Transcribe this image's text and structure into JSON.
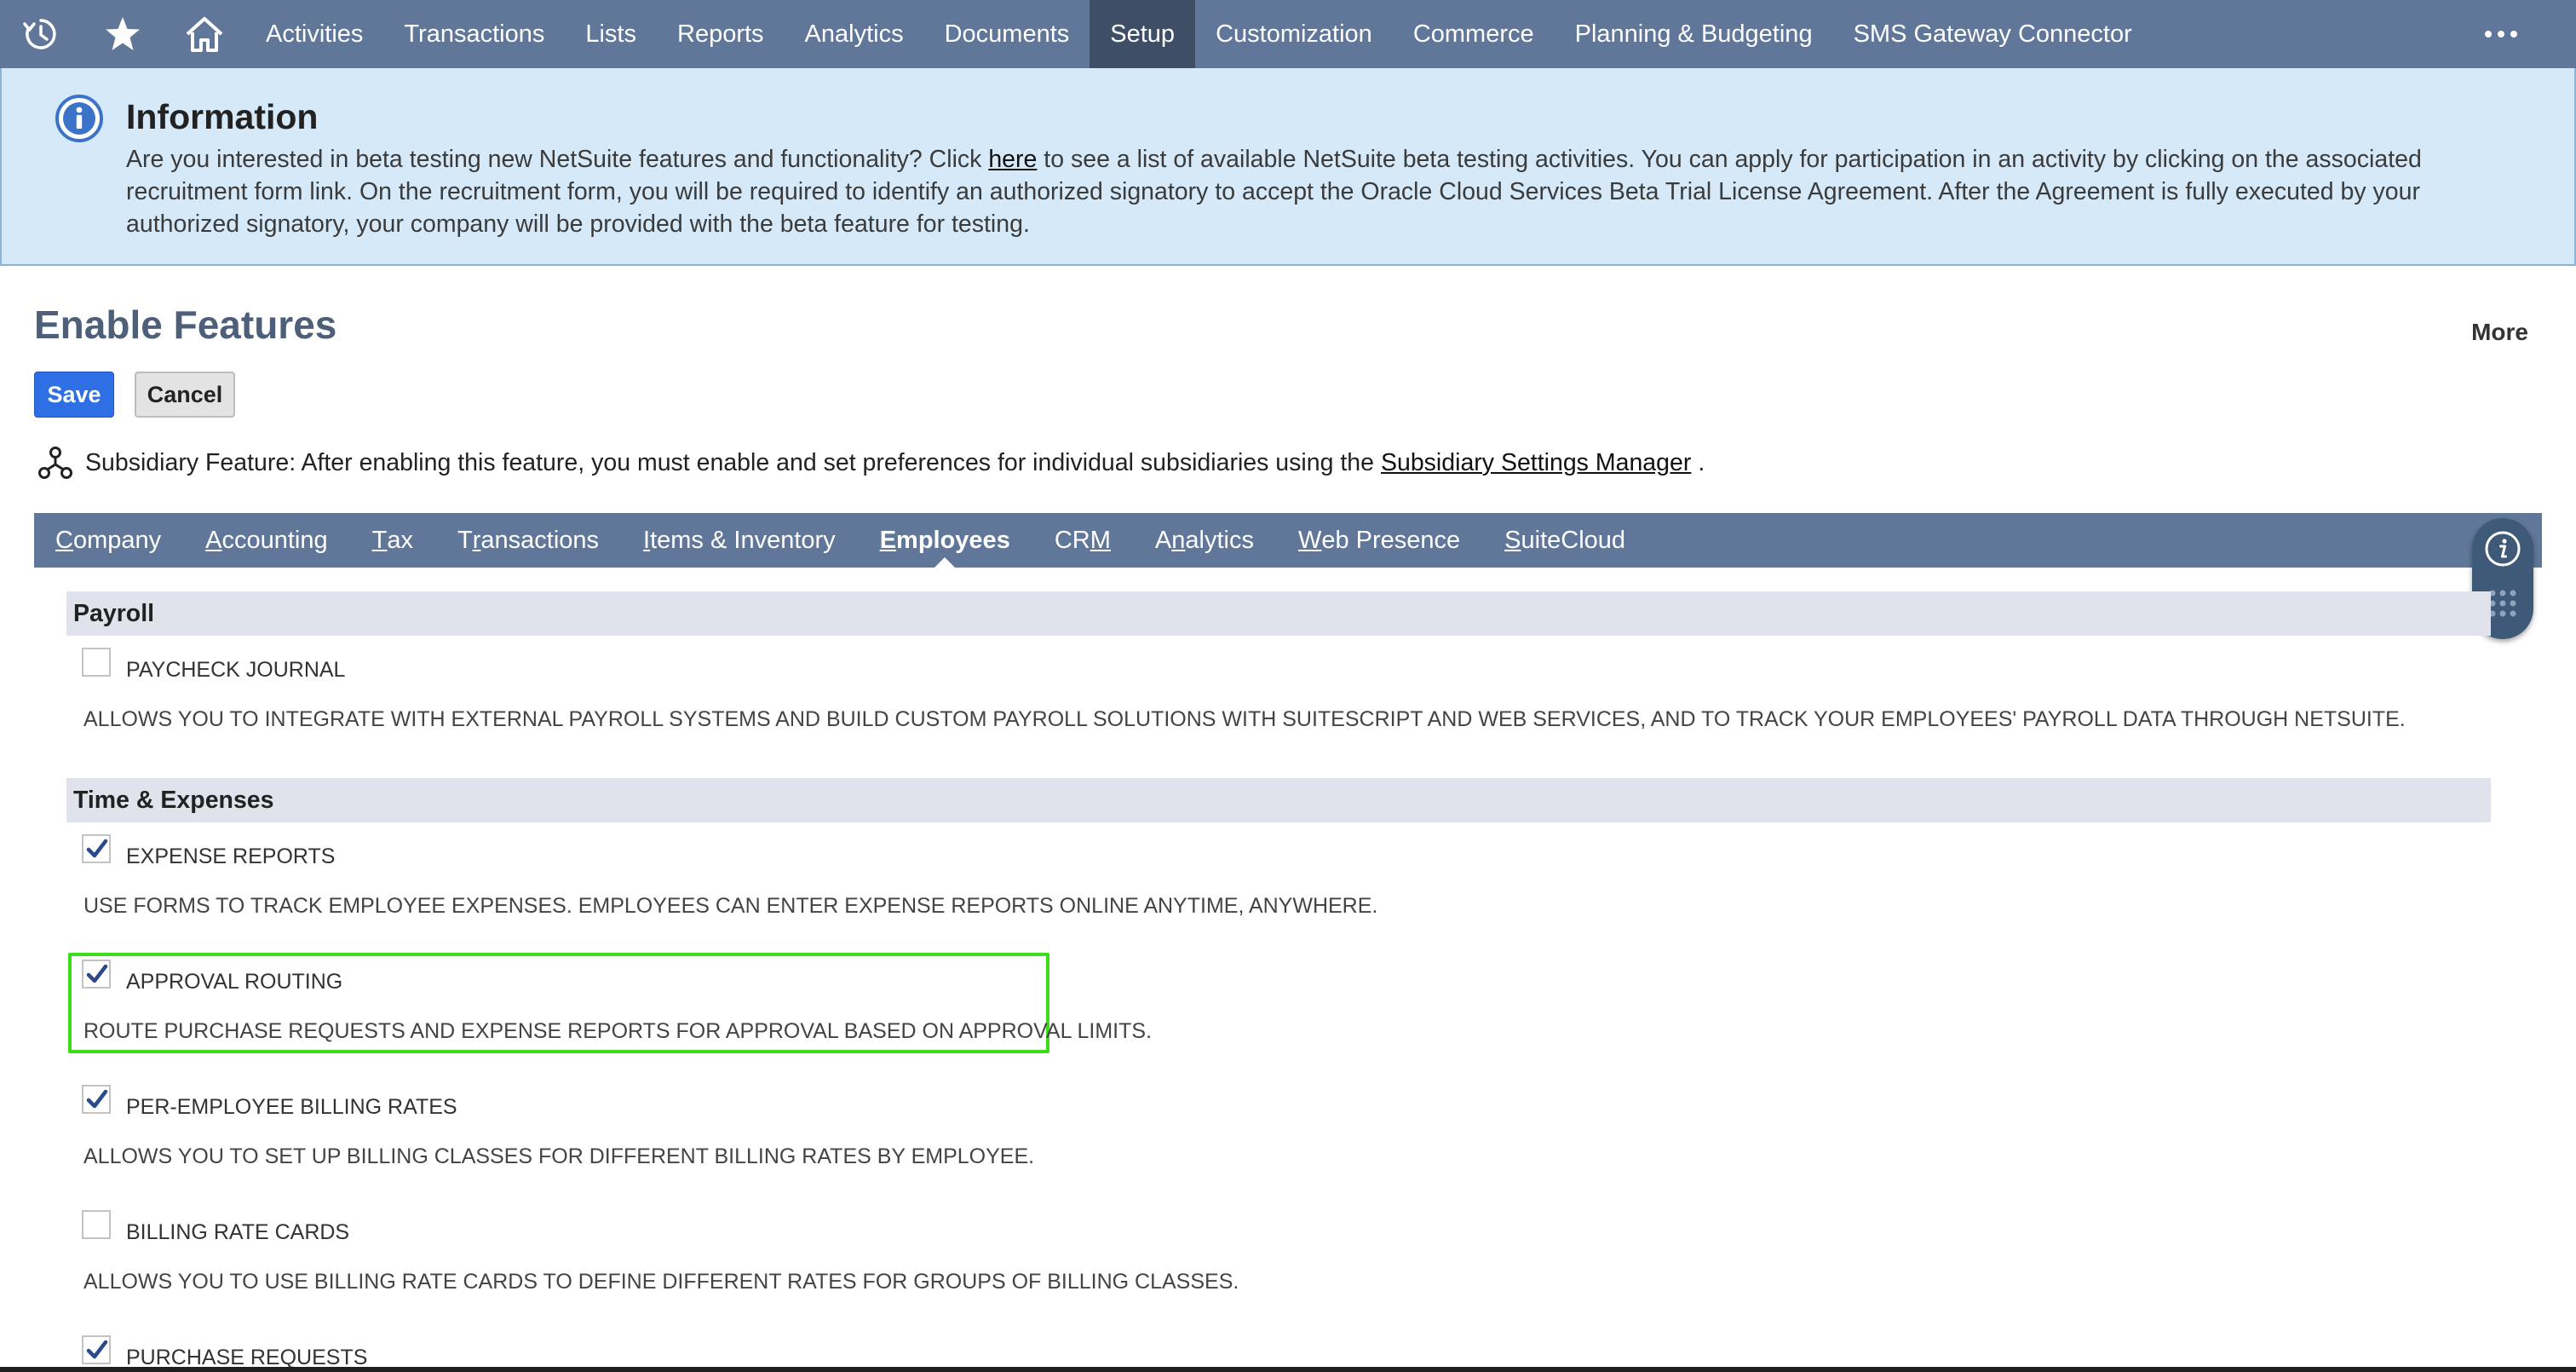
{
  "topnav": {
    "icons": [
      "recent-records-icon",
      "star-icon",
      "home-icon"
    ],
    "items": [
      {
        "label": "Activities"
      },
      {
        "label": "Transactions"
      },
      {
        "label": "Lists"
      },
      {
        "label": "Reports"
      },
      {
        "label": "Analytics"
      },
      {
        "label": "Documents"
      },
      {
        "label": "Setup",
        "active": true
      },
      {
        "label": "Customization"
      },
      {
        "label": "Commerce"
      },
      {
        "label": "Planning & Budgeting"
      },
      {
        "label": "SMS Gateway Connector"
      }
    ],
    "more_icon": "ellipsis-icon"
  },
  "banner": {
    "title": "Information",
    "text_before_link": "Are you interested in beta testing new NetSuite features and functionality? Click ",
    "link": "here",
    "text_after_link": " to see a list of available NetSuite beta testing activities. You can apply for participation in an activity by clicking on the associated recruitment form link. On the recruitment form, you will be required to identify an authorized signatory to accept the Oracle Cloud Services Beta Trial License Agreement. After the Agreement is fully executed by your authorized signatory, your company will be provided with the beta feature for testing."
  },
  "page": {
    "title": "Enable Features",
    "more": "More",
    "save": "Save",
    "cancel": "Cancel"
  },
  "subsidiary_note": {
    "text": "Subsidiary Feature: After enabling this feature, you must enable and set preferences for individual subsidiaries using the",
    "link": "Subsidiary Settings Manager",
    "suffix": "."
  },
  "tabs": [
    {
      "label": "Company",
      "accesskey_index": 0
    },
    {
      "label": "Accounting",
      "accesskey_index": 0
    },
    {
      "label": "Tax",
      "accesskey_index": 0
    },
    {
      "label": "Transactions",
      "accesskey_index": 1
    },
    {
      "label": "Items & Inventory",
      "accesskey_index": 0
    },
    {
      "label": "Employees",
      "accesskey_index": 0,
      "active": true
    },
    {
      "label": "CRM",
      "accesskey_index": 2
    },
    {
      "label": "Analytics",
      "accesskey_index": 1
    },
    {
      "label": "Web Presence",
      "accesskey_index": 0
    },
    {
      "label": "SuiteCloud",
      "accesskey_index": 0
    }
  ],
  "sections": {
    "payroll": {
      "title": "Payroll",
      "features": [
        {
          "label": "PAYCHECK JOURNAL",
          "checked": false,
          "description": "ALLOWS YOU TO INTEGRATE WITH EXTERNAL PAYROLL SYSTEMS AND BUILD CUSTOM PAYROLL SOLUTIONS WITH SUITESCRIPT AND WEB SERVICES, AND TO TRACK YOUR EMPLOYEES' PAYROLL DATA THROUGH NETSUITE."
        }
      ]
    },
    "time_expenses": {
      "title": "Time & Expenses",
      "features": [
        {
          "label": "EXPENSE REPORTS",
          "checked": true,
          "description": "USE FORMS TO TRACK EMPLOYEE EXPENSES. EMPLOYEES CAN ENTER EXPENSE REPORTS ONLINE ANYTIME, ANYWHERE."
        },
        {
          "label": "APPROVAL ROUTING",
          "checked": true,
          "highlighted": true,
          "description": "ROUTE PURCHASE REQUESTS AND EXPENSE REPORTS FOR APPROVAL BASED ON APPROVAL LIMITS."
        },
        {
          "label": "PER-EMPLOYEE BILLING RATES",
          "checked": true,
          "description": "ALLOWS YOU TO SET UP BILLING CLASSES FOR DIFFERENT BILLING RATES BY EMPLOYEE."
        },
        {
          "label": "BILLING RATE CARDS",
          "checked": false,
          "description": "ALLOWS YOU TO USE BILLING RATE CARDS TO DEFINE DIFFERENT RATES FOR GROUPS OF BILLING CLASSES."
        },
        {
          "label": "PURCHASE REQUESTS",
          "checked": true
        }
      ]
    }
  },
  "colors": {
    "nav_bg": "#607799",
    "nav_active": "#3e4e66",
    "banner_bg": "#d5e9f8",
    "save_button": "#2f6fe6",
    "highlight_border": "#3ddc1a",
    "checkmark": "#2b4a8b"
  }
}
